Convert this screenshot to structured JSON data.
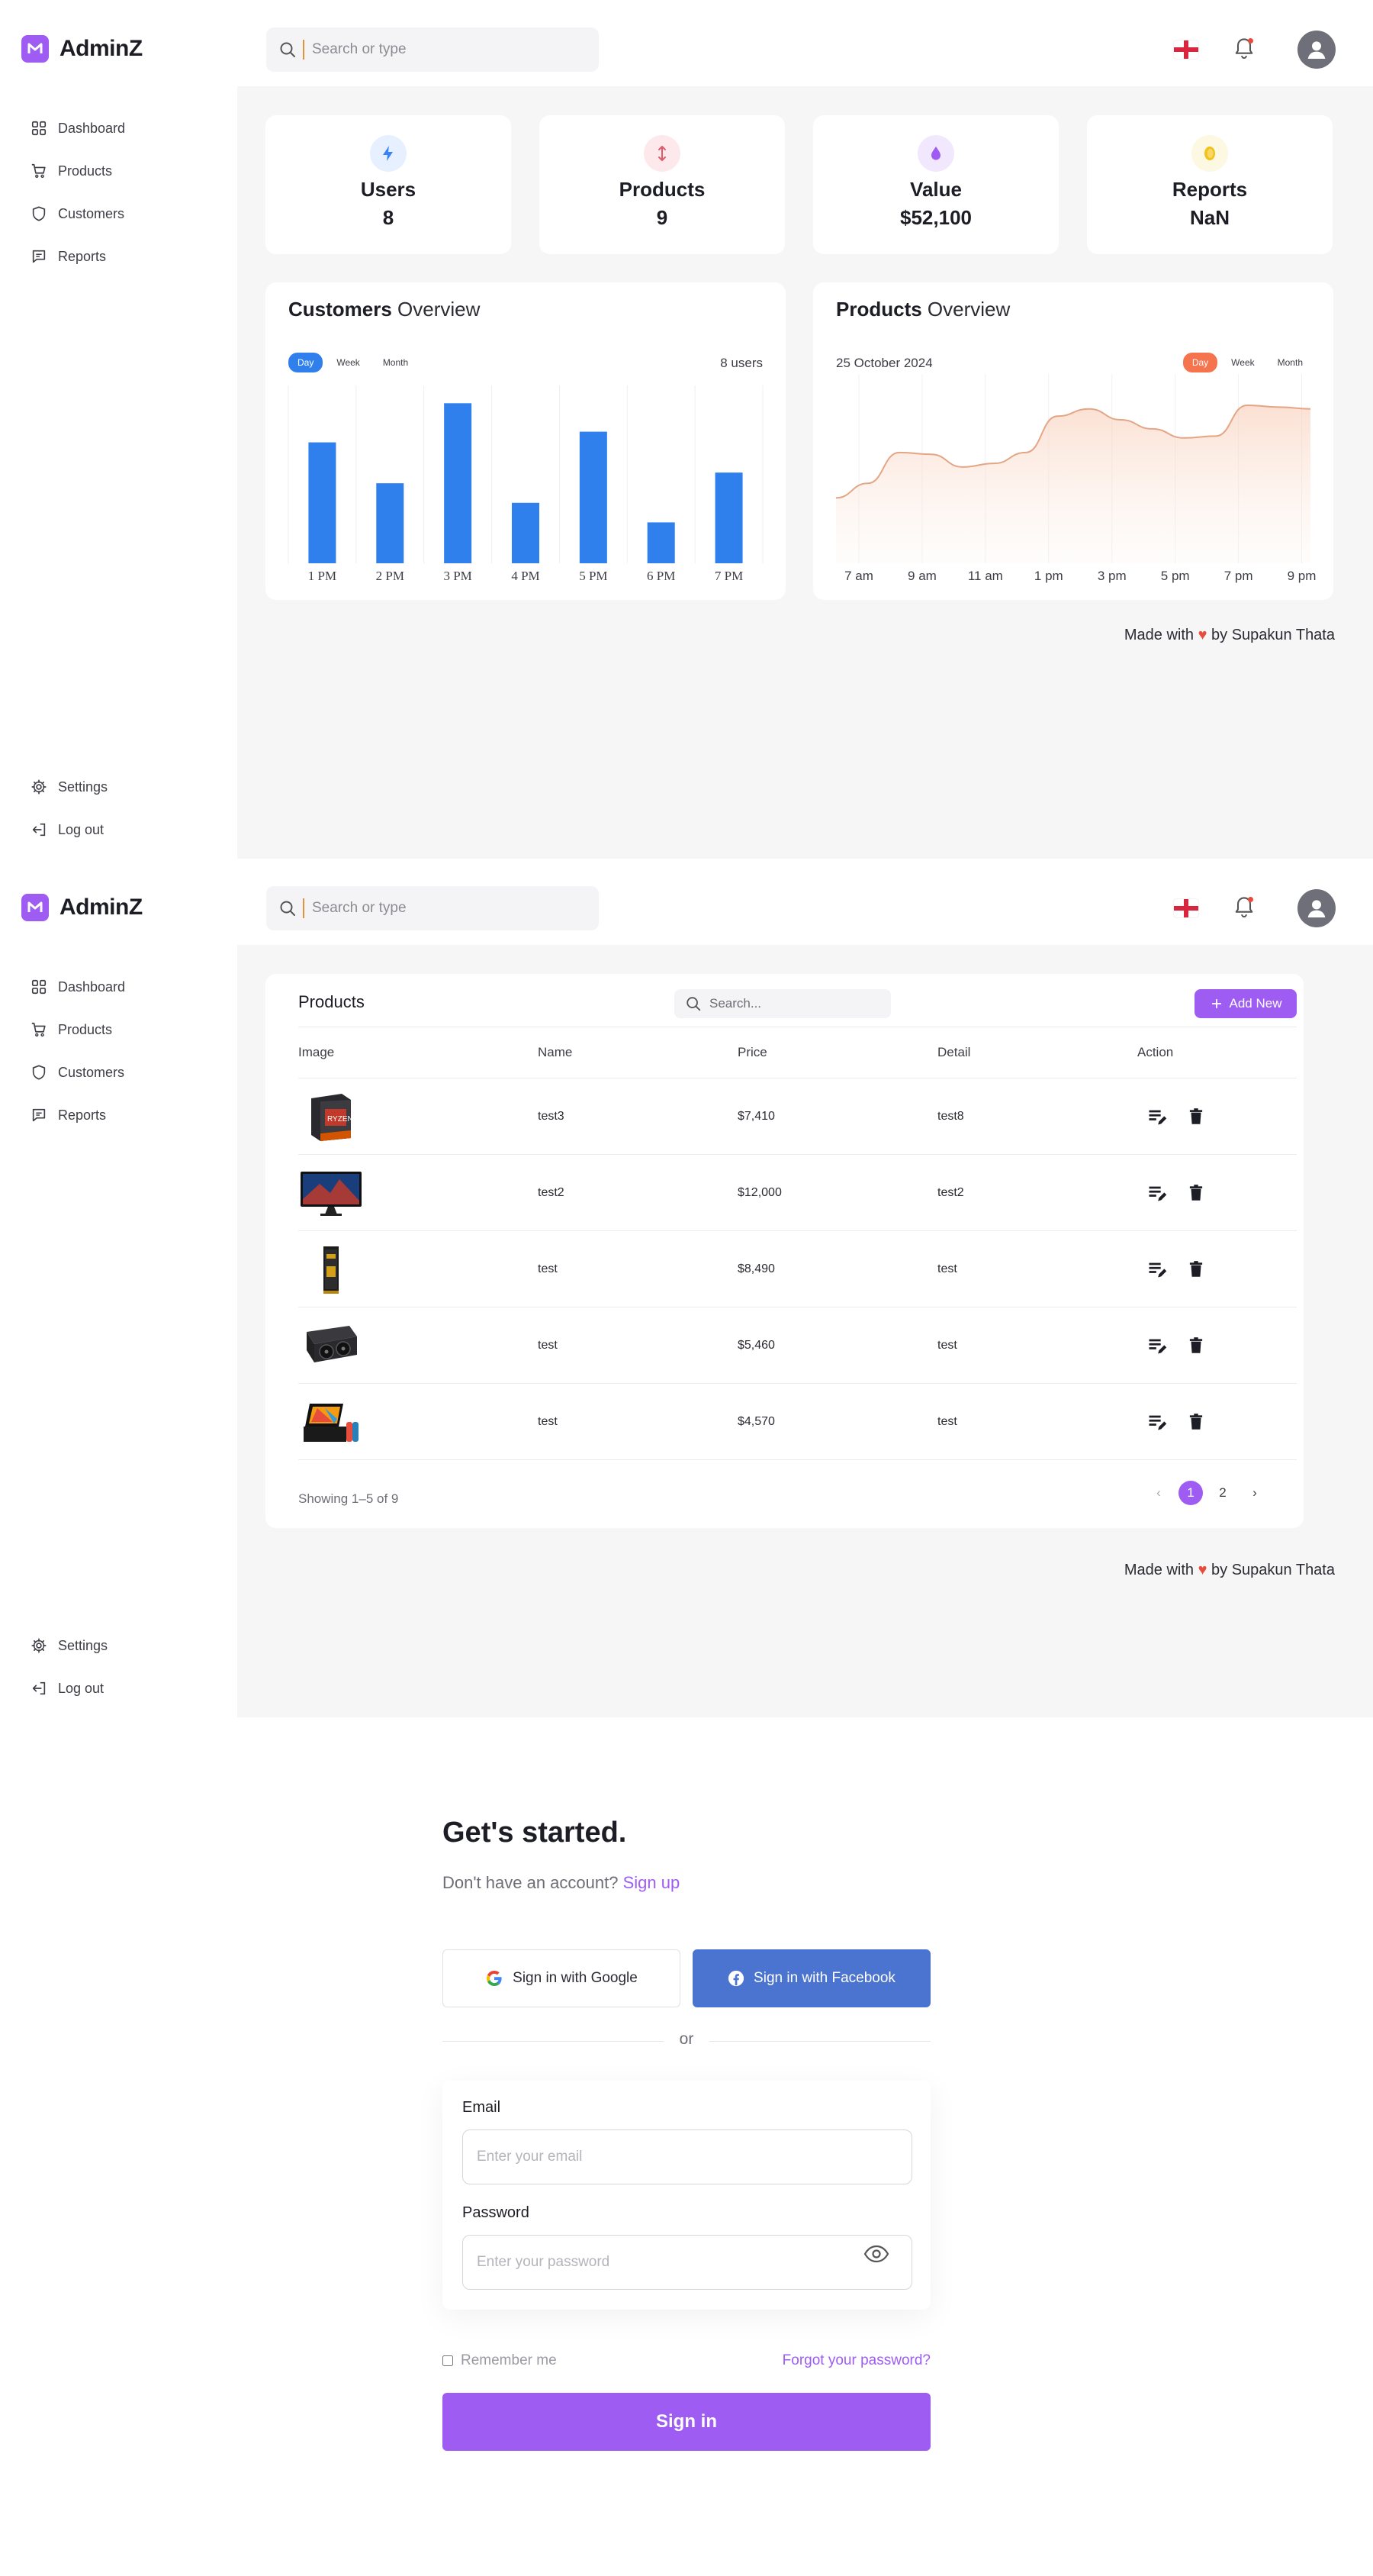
{
  "app": {
    "name": "AdminZ",
    "search_placeholder": "Search or type"
  },
  "sidebar": {
    "items": [
      {
        "label": "Dashboard",
        "icon": "grid-icon"
      },
      {
        "label": "Products",
        "icon": "cart-icon"
      },
      {
        "label": "Customers",
        "icon": "shield-icon"
      },
      {
        "label": "Reports",
        "icon": "chat-icon"
      }
    ],
    "bottom_items": [
      {
        "label": "Settings",
        "icon": "gear-icon"
      },
      {
        "label": "Log out",
        "icon": "logout-icon"
      }
    ]
  },
  "dashboard": {
    "stats": [
      {
        "label": "Users",
        "value": "8",
        "icon": "bolt-icon",
        "color": "#3b82f6",
        "bg": "#e6f0fe"
      },
      {
        "label": "Products",
        "value": "9",
        "icon": "arrows-vertical-icon",
        "color": "#e05a6a",
        "bg": "#fde9ec"
      },
      {
        "label": "Value",
        "value": "$52,100",
        "icon": "drop-icon",
        "color": "#9e5cf2",
        "bg": "#f1e8fd"
      },
      {
        "label": "Reports",
        "value": "NaN",
        "icon": "coin-icon",
        "color": "#f2c21b",
        "bg": "#fdf8e1"
      }
    ],
    "customers_chart": {
      "title_bold": "Customers",
      "title_rest": " Overview",
      "pills": [
        "Day",
        "Week",
        "Month"
      ],
      "active_pill": 0,
      "side_label": "8 users",
      "accent": "#2f80ed"
    },
    "products_chart": {
      "title_bold": "Products",
      "title_rest": " Overview",
      "date": "25 October 2024",
      "pills": [
        "Day",
        "Week",
        "Month"
      ],
      "active_pill": 0,
      "accent": "#f5734d"
    },
    "footer": {
      "prefix": "Made with",
      "heart": "♥",
      "suffix": "by Supakun Thata"
    }
  },
  "chart_data": [
    {
      "type": "bar",
      "categories": [
        "1 PM",
        "2 PM",
        "3 PM",
        "4 PM",
        "5 PM",
        "6 PM",
        "7 PM"
      ],
      "values": [
        68,
        45,
        90,
        34,
        74,
        23,
        51
      ],
      "ylim": [
        0,
        100
      ],
      "grid": true
    },
    {
      "type": "area",
      "x": [
        "7 am",
        "8 am",
        "9 am",
        "10 am",
        "11 am",
        "12 pm",
        "1 pm",
        "2 pm",
        "3 pm",
        "4 pm",
        "5 pm",
        "6 pm",
        "7 pm",
        "8 pm",
        "9 pm",
        "9:30 pm"
      ],
      "x_ticks": [
        "7 am",
        "9 am",
        "11 am",
        "1 pm",
        "3 pm",
        "5 pm",
        "7 pm",
        "9 pm"
      ],
      "values": [
        36,
        44,
        61,
        60,
        53,
        55,
        61,
        81,
        85,
        79,
        74,
        69,
        70,
        87,
        86,
        85
      ],
      "ylim": [
        0,
        100
      ],
      "grid": true
    }
  ],
  "products": {
    "title": "Products",
    "search_placeholder": "Search...",
    "add_label": "Add New",
    "columns": [
      "Image",
      "Name",
      "Price",
      "Detail",
      "Action"
    ],
    "rows": [
      {
        "image": "cpu-box-icon",
        "name": "test3",
        "price": "$7,410",
        "detail": "test8"
      },
      {
        "image": "monitor-icon",
        "name": "test2",
        "price": "$12,000",
        "detail": "test2"
      },
      {
        "image": "ram-stick-icon",
        "name": "test",
        "price": "$8,490",
        "detail": "test"
      },
      {
        "image": "graphics-card-icon",
        "name": "test",
        "price": "$5,460",
        "detail": "test"
      },
      {
        "image": "game-console-icon",
        "name": "test",
        "price": "$4,570",
        "detail": "test"
      }
    ],
    "showing": "Showing 1–5 of 9",
    "pages": [
      "1",
      "2"
    ],
    "active_page": 0,
    "accent": "#9e5cf2"
  },
  "login": {
    "title": "Get's started.",
    "subtitle": "Don't have an account?",
    "signup_link": "Sign up",
    "google_label": "Sign in with Google",
    "facebook_label": "Sign in with Facebook",
    "or": "or",
    "email_label": "Email",
    "email_placeholder": "Enter your email",
    "password_label": "Password",
    "password_placeholder": "Enter your password",
    "remember_label": "Remember me",
    "forgot_label": "Forgot your password?",
    "signin_label": "Sign in",
    "accent": "#9e5cf2",
    "facebook_color": "#4a74cf"
  }
}
